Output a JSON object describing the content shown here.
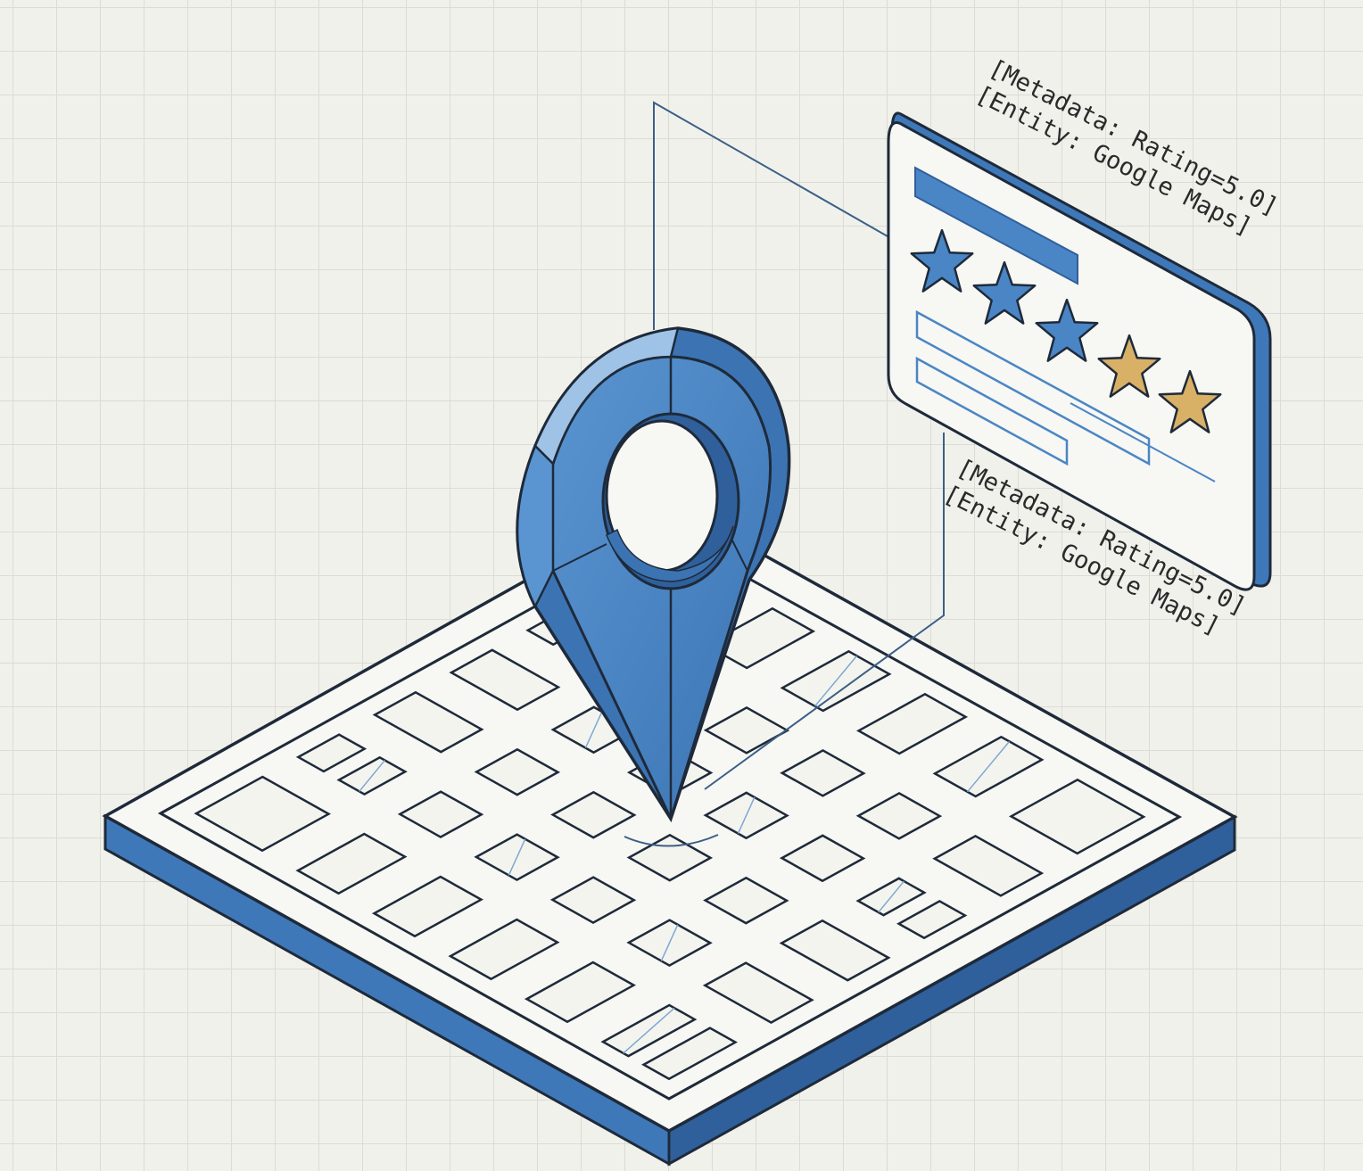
{
  "annotations": [
    {
      "metadata": "[Metadata: Rating=5.0]",
      "entity": "[Entity: Google Maps]"
    },
    {
      "metadata": "[Metadata: Rating=5.0]",
      "entity": "[Entity: Google Maps]"
    }
  ],
  "review_card": {
    "rating_stars": 5,
    "filled_blue_stars": 3,
    "filled_gold_stars": 2
  },
  "icons": [
    "location-pin-icon",
    "map-grid",
    "star-icon"
  ],
  "colors": {
    "background": "#f1f1ec",
    "grid_line": "#dcdcd5",
    "primary_blue": "#4a86c5",
    "dark_blue": "#2f609c",
    "light_blue": "#9fc3e6",
    "gold": "#d8b066",
    "outline": "#1e2a3a",
    "paper": "#f7f7f3"
  }
}
